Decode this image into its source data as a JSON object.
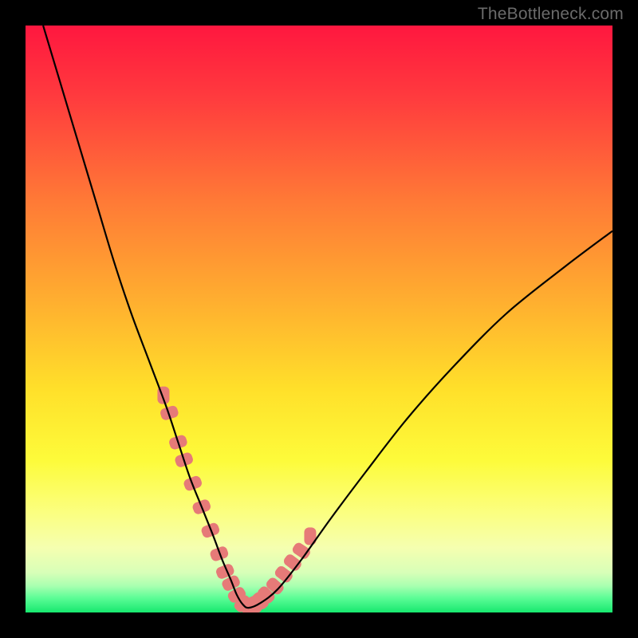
{
  "watermark": "TheBottleneck.com",
  "colors": {
    "frame": "#000000",
    "curve": "#000000",
    "marker": "#e67a78",
    "gradient_stops": [
      {
        "offset": 0.0,
        "color": "#ff173f"
      },
      {
        "offset": 0.12,
        "color": "#ff3a3e"
      },
      {
        "offset": 0.3,
        "color": "#ff7a36"
      },
      {
        "offset": 0.48,
        "color": "#ffb22f"
      },
      {
        "offset": 0.62,
        "color": "#ffe02a"
      },
      {
        "offset": 0.74,
        "color": "#fdfb3a"
      },
      {
        "offset": 0.83,
        "color": "#fbff80"
      },
      {
        "offset": 0.89,
        "color": "#f5ffb0"
      },
      {
        "offset": 0.932,
        "color": "#d8ffb8"
      },
      {
        "offset": 0.955,
        "color": "#a8ffb0"
      },
      {
        "offset": 0.975,
        "color": "#5dfd96"
      },
      {
        "offset": 1.0,
        "color": "#17e86f"
      }
    ]
  },
  "chart_data": {
    "type": "line",
    "title": "",
    "xlabel": "",
    "ylabel": "",
    "xlim": [
      0,
      100
    ],
    "ylim": [
      0,
      100
    ],
    "series": [
      {
        "name": "bottleneck-curve",
        "x": [
          3,
          6,
          9,
          12,
          15,
          18,
          21,
          24,
          26,
          28,
          30,
          32,
          33.5,
          35,
          36,
          37,
          38,
          40,
          43,
          47,
          52,
          58,
          65,
          73,
          82,
          92,
          100
        ],
        "y": [
          100,
          90,
          80,
          70,
          60,
          51,
          43,
          35,
          29,
          23,
          18,
          13,
          9,
          5.5,
          3,
          1.4,
          0.8,
          1.6,
          4,
          9,
          16,
          24,
          33,
          42,
          51,
          59,
          65
        ]
      }
    ],
    "markers": {
      "name": "highlight-points",
      "x": [
        23.5,
        24.5,
        26,
        27,
        28.5,
        30,
        31.5,
        33,
        34,
        35,
        36,
        37,
        38,
        39,
        40,
        41,
        42.5,
        44,
        45.5,
        47,
        48.5
      ],
      "y": [
        37,
        34,
        29,
        26,
        22,
        18,
        14,
        10,
        7,
        5,
        3,
        1.5,
        1,
        1.3,
        2,
        3,
        4.5,
        6.5,
        8.5,
        10.5,
        13
      ]
    }
  }
}
